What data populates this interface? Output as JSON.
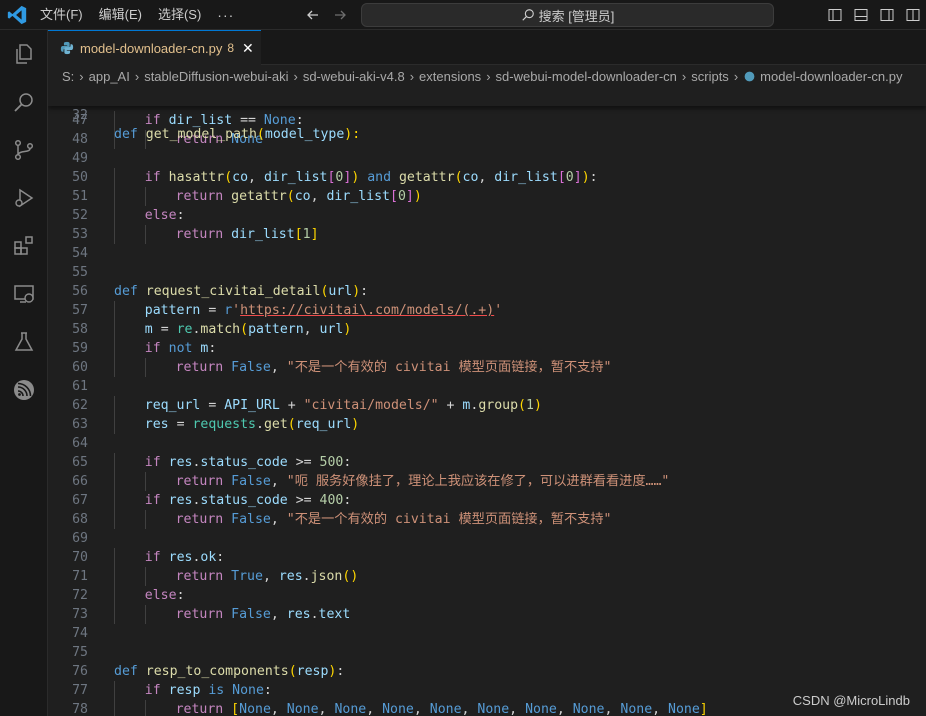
{
  "menu": {
    "file": "文件(F)",
    "edit": "编辑(E)",
    "selection": "选择(S)",
    "more": "···"
  },
  "search": {
    "text": "搜索 [管理员]"
  },
  "tab": {
    "name": "model-downloader-cn.py",
    "badge": "8",
    "close": "✕"
  },
  "breadcrumb": [
    "S:",
    "app_AI",
    "stableDiffusion-webui-aki",
    "sd-webui-aki-v4.8",
    "extensions",
    "sd-webui-model-downloader-cn",
    "scripts",
    "model-downloader-cn.py"
  ],
  "sticky": {
    "number": "32",
    "tokens": [
      [
        "kw",
        "def "
      ],
      [
        "fn",
        "get_model_path"
      ],
      [
        "b1",
        "("
      ],
      [
        "par",
        "model_type"
      ],
      [
        "b1",
        "):"
      ]
    ]
  },
  "lines": [
    {
      "number": "47",
      "indent": 1,
      "tokens": [
        [
          "ctl",
          "if "
        ],
        [
          "var",
          "dir_list"
        ],
        [
          "op",
          " == "
        ],
        [
          "const",
          "None"
        ],
        [
          "op",
          ":"
        ]
      ]
    },
    {
      "number": "48",
      "indent": 2,
      "tokens": [
        [
          "ctl",
          "return "
        ],
        [
          "const",
          "None"
        ]
      ]
    },
    {
      "number": "49",
      "indent": 0,
      "tokens": []
    },
    {
      "number": "50",
      "indent": 1,
      "tokens": [
        [
          "ctl",
          "if "
        ],
        [
          "fn",
          "hasattr"
        ],
        [
          "b1",
          "("
        ],
        [
          "var",
          "co"
        ],
        [
          "op",
          ", "
        ],
        [
          "var",
          "dir_list"
        ],
        [
          "b2",
          "["
        ],
        [
          "num",
          "0"
        ],
        [
          "b2",
          "]"
        ],
        [
          "b1",
          ")"
        ],
        [
          "kw",
          " and "
        ],
        [
          "fn",
          "getattr"
        ],
        [
          "b1",
          "("
        ],
        [
          "var",
          "co"
        ],
        [
          "op",
          ", "
        ],
        [
          "var",
          "dir_list"
        ],
        [
          "b2",
          "["
        ],
        [
          "num",
          "0"
        ],
        [
          "b2",
          "]"
        ],
        [
          "b1",
          ")"
        ],
        [
          "op",
          ":"
        ]
      ]
    },
    {
      "number": "51",
      "indent": 2,
      "tokens": [
        [
          "ctl",
          "return "
        ],
        [
          "fn",
          "getattr"
        ],
        [
          "b1",
          "("
        ],
        [
          "var",
          "co"
        ],
        [
          "op",
          ", "
        ],
        [
          "var",
          "dir_list"
        ],
        [
          "b2",
          "["
        ],
        [
          "num",
          "0"
        ],
        [
          "b2",
          "]"
        ],
        [
          "b1",
          ")"
        ]
      ]
    },
    {
      "number": "52",
      "indent": 1,
      "tokens": [
        [
          "ctl",
          "else"
        ],
        [
          "op",
          ":"
        ]
      ]
    },
    {
      "number": "53",
      "indent": 2,
      "tokens": [
        [
          "ctl",
          "return "
        ],
        [
          "var",
          "dir_list"
        ],
        [
          "b1",
          "["
        ],
        [
          "num",
          "1"
        ],
        [
          "b1",
          "]"
        ]
      ]
    },
    {
      "number": "54",
      "indent": 0,
      "tokens": []
    },
    {
      "number": "55",
      "indent": 0,
      "tokens": []
    },
    {
      "number": "56",
      "indent": 0,
      "tokens": [
        [
          "kw",
          "def "
        ],
        [
          "fn",
          "request_civitai_detail"
        ],
        [
          "b1",
          "("
        ],
        [
          "par",
          "url"
        ],
        [
          "b1",
          ")"
        ],
        [
          "op",
          ":"
        ]
      ]
    },
    {
      "number": "57",
      "indent": 1,
      "tokens": [
        [
          "var",
          "pattern"
        ],
        [
          "op",
          " = "
        ],
        [
          "kw",
          "r"
        ],
        [
          "str",
          "'"
        ],
        [
          "url",
          "https://civitai\\.com/models/(.+)"
        ],
        [
          "str",
          "'"
        ]
      ]
    },
    {
      "number": "58",
      "indent": 1,
      "tokens": [
        [
          "var",
          "m"
        ],
        [
          "op",
          " = "
        ],
        [
          "cls",
          "re"
        ],
        [
          "op",
          "."
        ],
        [
          "fn",
          "match"
        ],
        [
          "b1",
          "("
        ],
        [
          "var",
          "pattern"
        ],
        [
          "op",
          ", "
        ],
        [
          "par",
          "url"
        ],
        [
          "b1",
          ")"
        ]
      ]
    },
    {
      "number": "59",
      "indent": 1,
      "tokens": [
        [
          "ctl",
          "if "
        ],
        [
          "kw",
          "not "
        ],
        [
          "var",
          "m"
        ],
        [
          "op",
          ":"
        ]
      ]
    },
    {
      "number": "60",
      "indent": 2,
      "tokens": [
        [
          "ctl",
          "return "
        ],
        [
          "const",
          "False"
        ],
        [
          "op",
          ", "
        ],
        [
          "str",
          "\"不是一个有效的 civitai 模型页面链接，暂不支持\""
        ]
      ]
    },
    {
      "number": "61",
      "indent": 0,
      "tokens": []
    },
    {
      "number": "62",
      "indent": 1,
      "tokens": [
        [
          "var",
          "req_url"
        ],
        [
          "op",
          " = "
        ],
        [
          "var",
          "API_URL"
        ],
        [
          "op",
          " + "
        ],
        [
          "str",
          "\"civitai/models/\""
        ],
        [
          "op",
          " + "
        ],
        [
          "var",
          "m"
        ],
        [
          "op",
          "."
        ],
        [
          "fn",
          "group"
        ],
        [
          "b1",
          "("
        ],
        [
          "num",
          "1"
        ],
        [
          "b1",
          ")"
        ]
      ]
    },
    {
      "number": "63",
      "indent": 1,
      "tokens": [
        [
          "var",
          "res"
        ],
        [
          "op",
          " = "
        ],
        [
          "cls",
          "requests"
        ],
        [
          "op",
          "."
        ],
        [
          "fn",
          "get"
        ],
        [
          "b1",
          "("
        ],
        [
          "var",
          "req_url"
        ],
        [
          "b1",
          ")"
        ]
      ]
    },
    {
      "number": "64",
      "indent": 0,
      "tokens": []
    },
    {
      "number": "65",
      "indent": 1,
      "tokens": [
        [
          "ctl",
          "if "
        ],
        [
          "var",
          "res"
        ],
        [
          "op",
          "."
        ],
        [
          "var",
          "status_code"
        ],
        [
          "op",
          " >= "
        ],
        [
          "num",
          "500"
        ],
        [
          "op",
          ":"
        ]
      ]
    },
    {
      "number": "66",
      "indent": 2,
      "tokens": [
        [
          "ctl",
          "return "
        ],
        [
          "const",
          "False"
        ],
        [
          "op",
          ", "
        ],
        [
          "str",
          "\"呃 服务好像挂了，理论上我应该在修了，可以进群看看进度……\""
        ]
      ]
    },
    {
      "number": "67",
      "indent": 1,
      "tokens": [
        [
          "ctl",
          "if "
        ],
        [
          "var",
          "res"
        ],
        [
          "op",
          "."
        ],
        [
          "var",
          "status_code"
        ],
        [
          "op",
          " >= "
        ],
        [
          "num",
          "400"
        ],
        [
          "op",
          ":"
        ]
      ]
    },
    {
      "number": "68",
      "indent": 2,
      "tokens": [
        [
          "ctl",
          "return "
        ],
        [
          "const",
          "False"
        ],
        [
          "op",
          ", "
        ],
        [
          "str",
          "\"不是一个有效的 civitai 模型页面链接，暂不支持\""
        ]
      ]
    },
    {
      "number": "69",
      "indent": 0,
      "tokens": []
    },
    {
      "number": "70",
      "indent": 1,
      "tokens": [
        [
          "ctl",
          "if "
        ],
        [
          "var",
          "res"
        ],
        [
          "op",
          "."
        ],
        [
          "var",
          "ok"
        ],
        [
          "op",
          ":"
        ]
      ]
    },
    {
      "number": "71",
      "indent": 2,
      "tokens": [
        [
          "ctl",
          "return "
        ],
        [
          "const",
          "True"
        ],
        [
          "op",
          ", "
        ],
        [
          "var",
          "res"
        ],
        [
          "op",
          "."
        ],
        [
          "fn",
          "json"
        ],
        [
          "b1",
          "()"
        ]
      ]
    },
    {
      "number": "72",
      "indent": 1,
      "tokens": [
        [
          "ctl",
          "else"
        ],
        [
          "op",
          ":"
        ]
      ]
    },
    {
      "number": "73",
      "indent": 2,
      "tokens": [
        [
          "ctl",
          "return "
        ],
        [
          "const",
          "False"
        ],
        [
          "op",
          ", "
        ],
        [
          "var",
          "res"
        ],
        [
          "op",
          "."
        ],
        [
          "var",
          "text"
        ]
      ]
    },
    {
      "number": "74",
      "indent": 0,
      "tokens": []
    },
    {
      "number": "75",
      "indent": 0,
      "tokens": []
    },
    {
      "number": "76",
      "indent": 0,
      "tokens": [
        [
          "kw",
          "def "
        ],
        [
          "fn",
          "resp_to_components"
        ],
        [
          "b1",
          "("
        ],
        [
          "par",
          "resp"
        ],
        [
          "b1",
          ")"
        ],
        [
          "op",
          ":"
        ]
      ]
    },
    {
      "number": "77",
      "indent": 1,
      "tokens": [
        [
          "ctl",
          "if "
        ],
        [
          "par",
          "resp"
        ],
        [
          "kw",
          " is "
        ],
        [
          "const",
          "None"
        ],
        [
          "op",
          ":"
        ]
      ]
    },
    {
      "number": "78",
      "indent": 2,
      "tokens": [
        [
          "ctl",
          "return "
        ],
        [
          "b1",
          "["
        ],
        [
          "const",
          "None"
        ],
        [
          "op",
          ", "
        ],
        [
          "const",
          "None"
        ],
        [
          "op",
          ", "
        ],
        [
          "const",
          "None"
        ],
        [
          "op",
          ", "
        ],
        [
          "const",
          "None"
        ],
        [
          "op",
          ", "
        ],
        [
          "const",
          "None"
        ],
        [
          "op",
          ", "
        ],
        [
          "const",
          "None"
        ],
        [
          "op",
          ", "
        ],
        [
          "const",
          "None"
        ],
        [
          "op",
          ", "
        ],
        [
          "const",
          "None"
        ],
        [
          "op",
          ", "
        ],
        [
          "const",
          "None"
        ],
        [
          "op",
          ", "
        ],
        [
          "const",
          "None"
        ],
        [
          "b1",
          "]"
        ]
      ]
    }
  ],
  "watermark": "CSDN @MicroLindb",
  "colors": {
    "accent": "#0078d4",
    "editor_bg": "#1f1f1f",
    "chrome_bg": "#181818",
    "tab_text": "#e2c08d"
  },
  "icons": [
    "vscode-logo",
    "explorer-icon",
    "search-icon",
    "source-control-icon",
    "run-debug-icon",
    "extensions-icon",
    "remote-explorer-icon",
    "testing-icon",
    "esp-idf-icon"
  ]
}
